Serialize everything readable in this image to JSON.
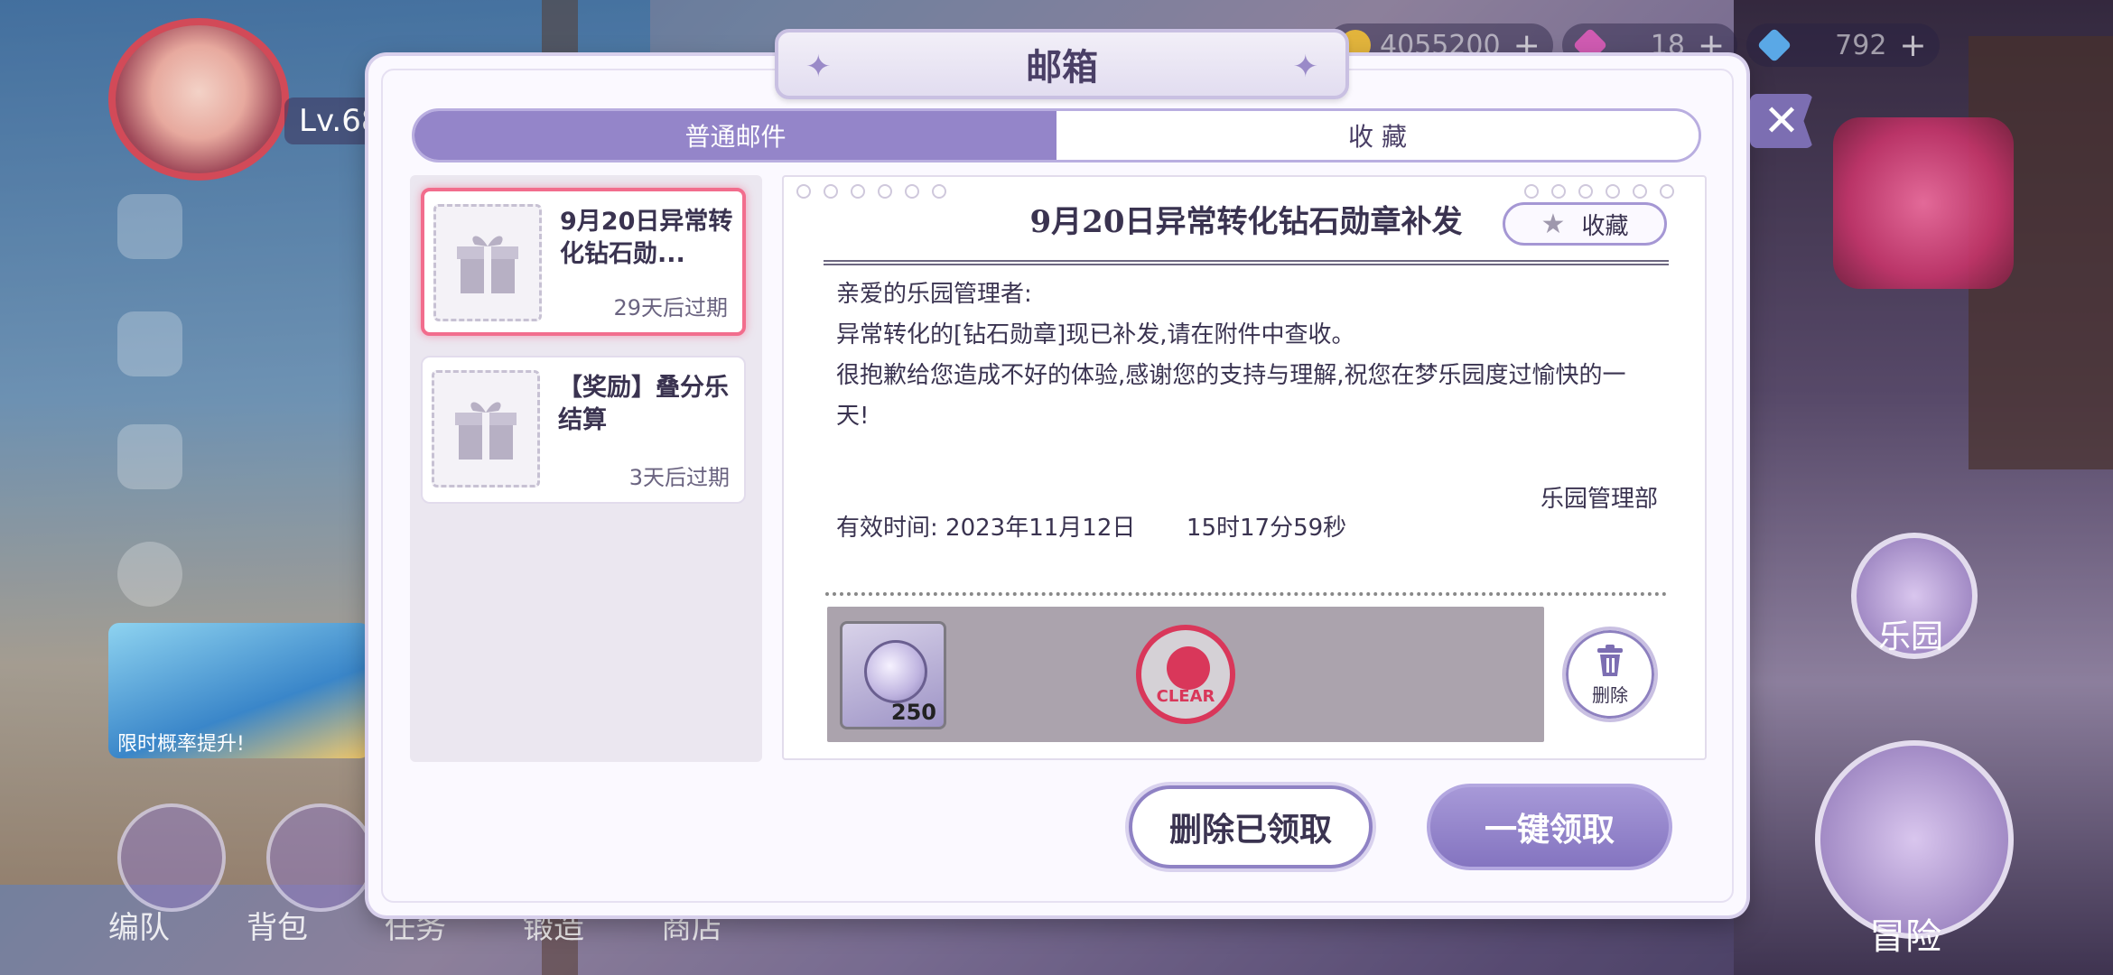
{
  "hud": {
    "currencies": [
      {
        "icon": "gold-coin-icon",
        "value": "4055200",
        "color": "#e2b43c"
      },
      {
        "icon": "pink-gem-icon",
        "value": "18",
        "color": "#d05bb2"
      },
      {
        "icon": "blue-diamond-icon",
        "value": "792",
        "color": "#5aa8e6"
      }
    ],
    "level": "Lv.68",
    "banner_subtitle": "限时概率提升!",
    "bottom_nav": [
      "编队",
      "背包",
      "任务",
      "锻造",
      "商店"
    ],
    "right_labels": {
      "park": "乐园",
      "adventure": "冒险"
    }
  },
  "dialog": {
    "title": "邮箱",
    "tabs": [
      {
        "label": "普通邮件",
        "active": true
      },
      {
        "label": "收 藏",
        "active": false
      }
    ],
    "mails": [
      {
        "title": "9月20日异常转化钻石勋...",
        "expire": "29天后过期",
        "selected": true
      },
      {
        "title": "【奖励】叠分乐结算",
        "expire": "3天后过期",
        "selected": false
      }
    ],
    "detail": {
      "title": "9月20日异常转化钻石勋章补发",
      "favorite_label": "收藏",
      "greeting": "亲爱的乐园管理者:",
      "line1": "异常转化的[钻石勋章]现已补发,请在附件中查收。",
      "line2": "很抱歉给您造成不好的体验,感谢您的支持与理解,祝您在梦乐园度过愉快的一天!",
      "signature": "乐园管理部",
      "validity_label": "有效时间:",
      "validity_date": "2023年11月12日",
      "validity_time": "15时17分59秒",
      "attachment_count": "250",
      "stamp_text": "CLEAR",
      "delete_label": "删除"
    },
    "buttons": {
      "delete_claimed": "删除已领取",
      "claim_all": "一键领取"
    }
  },
  "colors": {
    "accent": "#9485c9",
    "selected_border": "#f26d8d",
    "stamp": "#d9375a"
  }
}
